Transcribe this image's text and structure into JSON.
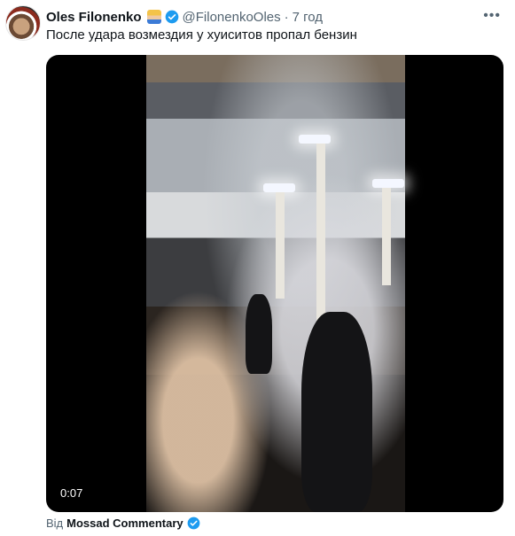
{
  "tweet": {
    "display_name": "Oles Filonenko",
    "emoji_icon": "woman-with-headscarf-emoji",
    "handle": "@FilonenkoOles",
    "separator": "·",
    "time": "7 год",
    "more_icon": "more-dots-icon",
    "text": "После удара возмездия у хуиситов пропал бензин",
    "verified_color": "#1d9bf0"
  },
  "media": {
    "duration": "0:07"
  },
  "attribution": {
    "prefix": "Від",
    "source_name": "Mossad Commentary"
  }
}
